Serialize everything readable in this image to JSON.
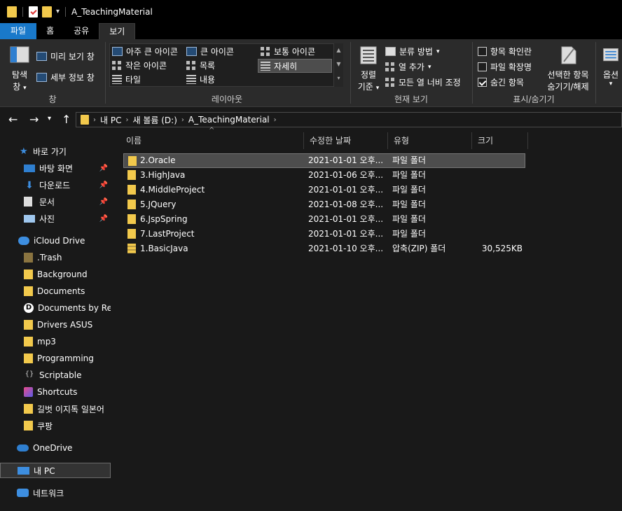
{
  "window": {
    "title": "A_TeachingMaterial"
  },
  "tabs": [
    {
      "label": "파일"
    },
    {
      "label": "홈"
    },
    {
      "label": "공유"
    },
    {
      "label": "보기"
    }
  ],
  "ribbon": {
    "pane": {
      "nav_pane_line1": "탐색",
      "nav_pane_line2": "창",
      "preview": "미리 보기 창",
      "details": "세부 정보 창",
      "group": "창"
    },
    "layout": {
      "items": [
        "아주 큰 아이콘",
        "큰 아이콘",
        "보통 아이콘",
        "작은 아이콘",
        "목록",
        "자세히",
        "타일",
        "내용"
      ],
      "group": "레이아웃"
    },
    "current_view": {
      "sort_line1": "정렬",
      "sort_line2": "기준",
      "group_by": "분류 방법",
      "add_columns": "열 추가",
      "fit_columns": "모든 열 너비 조정",
      "group": "현재 보기"
    },
    "show_hide": {
      "item_checkboxes": "항목 확인란",
      "file_extensions": "파일 확장명",
      "hidden_items": "숨긴 항목",
      "hide_selected_line1": "선택한 항목",
      "hide_selected_line2": "숨기기/해제",
      "group": "표시/숨기기",
      "item_checkboxes_checked": false,
      "file_extensions_checked": false,
      "hidden_items_checked": true
    },
    "options": {
      "label": "옵션"
    }
  },
  "address": {
    "crumbs": [
      "내 PC",
      "새 볼륨 (D:)",
      "A_TeachingMaterial"
    ]
  },
  "sidebar": {
    "items": [
      {
        "label": "바로 가기",
        "icon": "star-icon",
        "pinned": false
      },
      {
        "label": "바탕 화면",
        "icon": "desktop-icon",
        "pinned": true
      },
      {
        "label": "다운로드",
        "icon": "download-icon",
        "pinned": true
      },
      {
        "label": "문서",
        "icon": "document-icon",
        "pinned": true
      },
      {
        "label": "사진",
        "icon": "pictures-icon",
        "pinned": true
      },
      {
        "label": "iCloud Drive",
        "icon": "icloud-icon",
        "pinned": false
      },
      {
        "label": ".Trash",
        "icon": "folder-icon",
        "pinned": false
      },
      {
        "label": "Background",
        "icon": "folder-icon",
        "pinned": false
      },
      {
        "label": "Documents",
        "icon": "folder-icon",
        "pinned": false
      },
      {
        "label": "Documents by Rea",
        "icon": "readdle-icon",
        "pinned": false
      },
      {
        "label": "Drivers ASUS",
        "icon": "folder-icon",
        "pinned": false
      },
      {
        "label": "mp3",
        "icon": "folder-icon",
        "pinned": false
      },
      {
        "label": "Programming",
        "icon": "folder-icon",
        "pinned": false
      },
      {
        "label": "Scriptable",
        "icon": "scriptable-icon",
        "pinned": false
      },
      {
        "label": "Shortcuts",
        "icon": "shortcuts-icon",
        "pinned": false
      },
      {
        "label": "길벗 이지톡 일본어",
        "icon": "folder-icon",
        "pinned": false
      },
      {
        "label": "쿠팡",
        "icon": "folder-icon",
        "pinned": false
      },
      {
        "label": "OneDrive",
        "icon": "onedrive-icon",
        "pinned": false
      },
      {
        "label": "내 PC",
        "icon": "pc-icon",
        "pinned": false
      },
      {
        "label": "네트워크",
        "icon": "network-icon",
        "pinned": false
      }
    ]
  },
  "columns": {
    "name": "이름",
    "modified": "수정한 날짜",
    "type": "유형",
    "size": "크기"
  },
  "files": [
    {
      "name": "2.Oracle",
      "modified": "2021-01-01 오후...",
      "type": "파일 폴더",
      "size": "",
      "kind": "folder"
    },
    {
      "name": "3.HighJava",
      "modified": "2021-01-06 오후...",
      "type": "파일 폴더",
      "size": "",
      "kind": "folder"
    },
    {
      "name": "4.MiddleProject",
      "modified": "2021-01-01 오후...",
      "type": "파일 폴더",
      "size": "",
      "kind": "folder"
    },
    {
      "name": "5.JQuery",
      "modified": "2021-01-08 오후...",
      "type": "파일 폴더",
      "size": "",
      "kind": "folder"
    },
    {
      "name": "6.JspSpring",
      "modified": "2021-01-01 오후...",
      "type": "파일 폴더",
      "size": "",
      "kind": "folder"
    },
    {
      "name": "7.LastProject",
      "modified": "2021-01-01 오후...",
      "type": "파일 폴더",
      "size": "",
      "kind": "folder"
    },
    {
      "name": "1.BasicJava",
      "modified": "2021-01-10 오후...",
      "type": "압축(ZIP) 폴더",
      "size": "30,525KB",
      "kind": "zip"
    }
  ],
  "colors": {
    "file_tab": "#1979ca",
    "folder": "#f2c94c",
    "background": "#191919",
    "ribbon": "#2b2b2b"
  }
}
